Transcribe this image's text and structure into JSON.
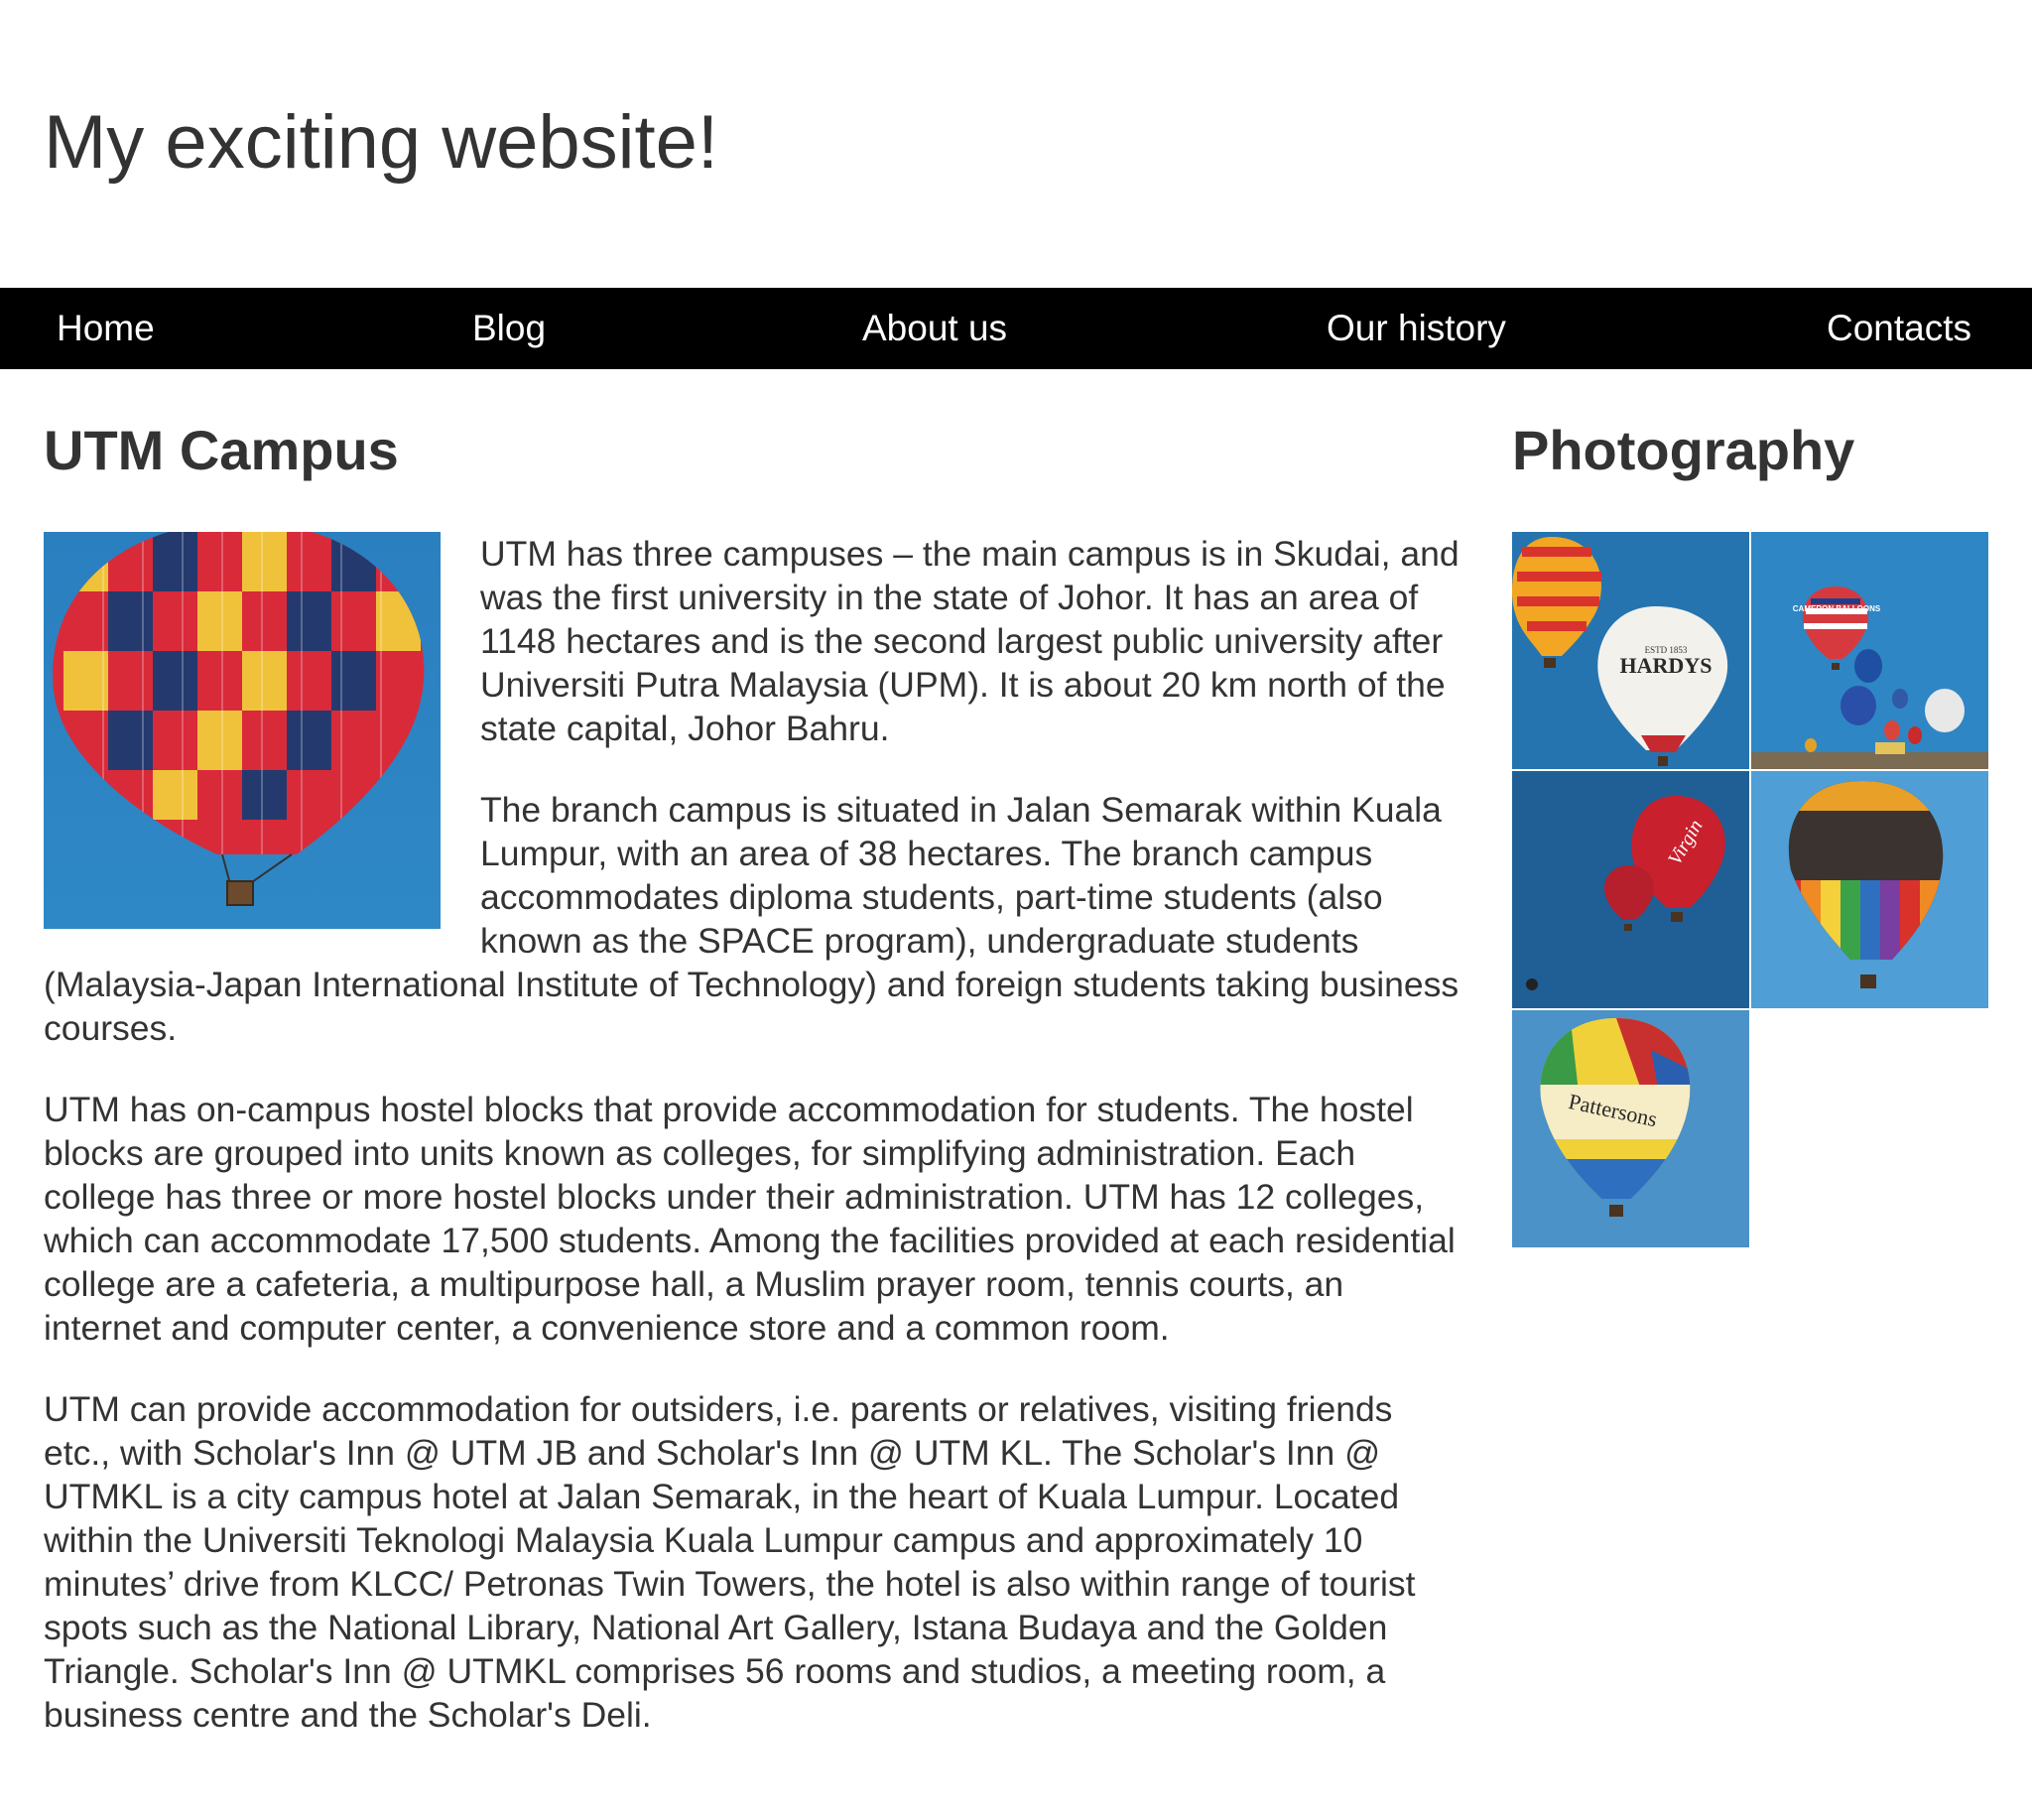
{
  "header": {
    "title": "My exciting website!"
  },
  "nav": {
    "items": [
      {
        "label": "Home"
      },
      {
        "label": "Blog"
      },
      {
        "label": "About us"
      },
      {
        "label": "Our history"
      },
      {
        "label": "Contacts"
      }
    ]
  },
  "main": {
    "heading": "UTM Campus",
    "image_subject": "hot-air-balloon",
    "paragraphs": [
      "UTM has three campuses – the main campus is in Skudai, and was the first university in the state of Johor. It has an area of 1148 hectares and is the second largest public university after Universiti Putra Malaysia (UPM). It is about 20 km north of the state capital, Johor Bahru.",
      "The branch campus is situated in Jalan Semarak within Kuala Lumpur, with an area of 38 hectares. The branch campus accommodates diploma students, part-time students (also known as the SPACE program), undergraduate students (Malaysia-Japan International Institute of Technology) and foreign students taking business courses.",
      "UTM has on-campus hostel blocks that provide accommodation for students. The hostel blocks are grouped into units known as colleges, for simplifying administration. Each college has three or more hostel blocks under their administration. UTM has 12 colleges, which can accommodate 17,500 students. Among the facilities provided at each residential college are a cafeteria, a multipurpose hall, a Muslim prayer room, tennis courts, an internet and computer center, a convenience store and a common room.",
      "UTM can provide accommodation for outsiders, i.e. parents or relatives, visiting friends etc., with Scholar's Inn @ UTM JB and Scholar's Inn @ UTM KL. The Scholar's Inn @ UTMKL is a city campus hotel at Jalan Semarak, in the heart of Kuala Lumpur. Located within the Universiti Teknologi Malaysia Kuala Lumpur campus and approximately 10 minutes’ drive from KLCC/ Petronas Twin Towers, the hotel is also within range of tourist spots such as the National Library, National Art Gallery, Istana Budaya and the Golden Triangle. Scholar's Inn @ UTMKL comprises 56 rooms and studios, a meeting room, a business centre and the Scholar's Deli."
    ]
  },
  "sidebar": {
    "heading": "Photography",
    "photos": [
      {
        "subject": "balloons-hardys",
        "balloon_text": "HARDYS",
        "balloon_subtext": "ESTD 1853"
      },
      {
        "subject": "balloons-festival",
        "balloon_text": "CAMERON BALLOONS"
      },
      {
        "subject": "balloons-virgin",
        "balloon_text": "Virgin"
      },
      {
        "subject": "balloon-rainbow"
      },
      {
        "subject": "balloon-pattersons",
        "balloon_text": "Pattersons"
      }
    ]
  },
  "colors": {
    "text": "#333333",
    "nav_background": "#000000",
    "nav_text": "#ffffff",
    "sky_blue": "#2b84c0"
  }
}
